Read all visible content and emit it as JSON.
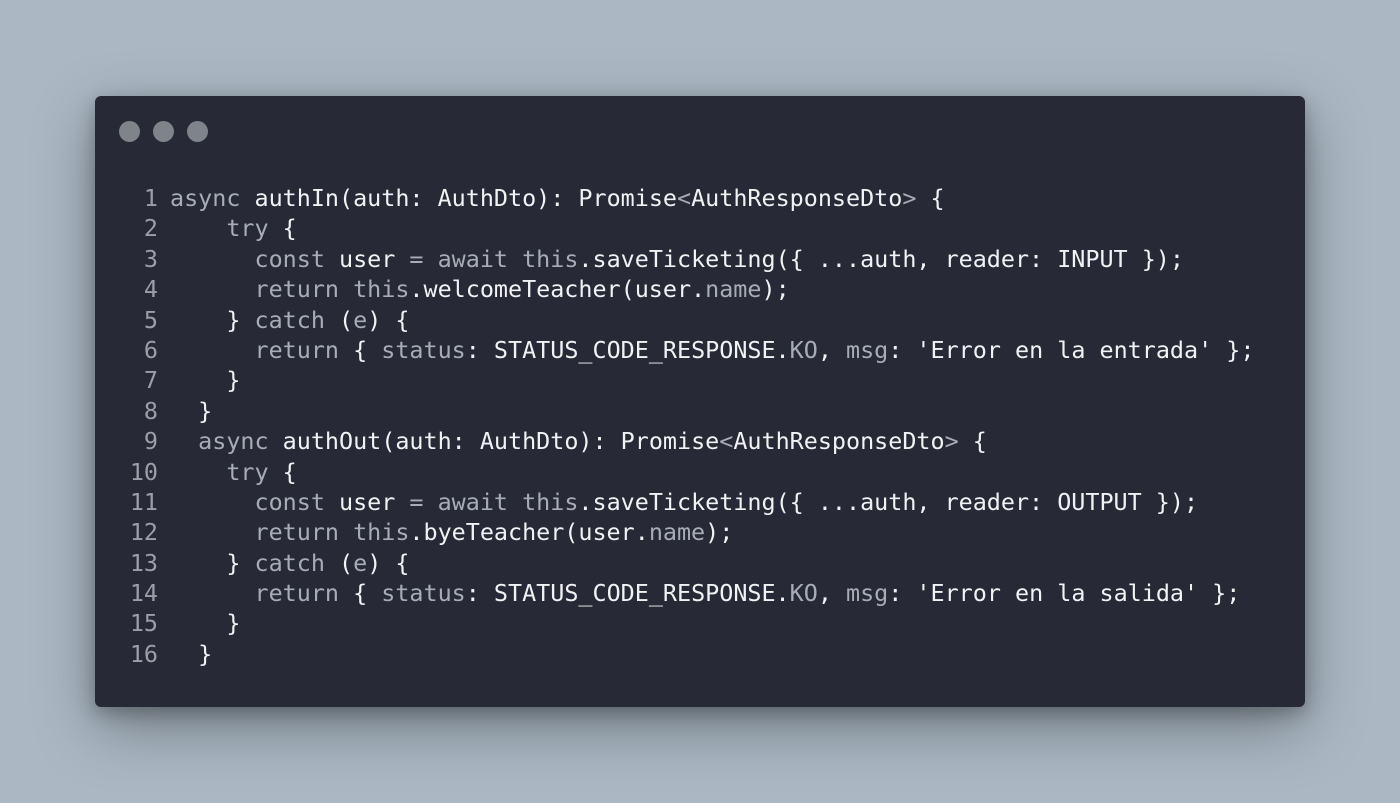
{
  "window": {
    "controls": [
      "close-icon",
      "minimize-icon",
      "maximize-icon"
    ],
    "background": "#272a36",
    "page_background": "#abb8c4"
  },
  "code": {
    "lines": [
      {
        "n": "1",
        "tokens": [
          [
            "kw",
            "async "
          ],
          [
            "fn",
            "authIn"
          ],
          [
            "fn",
            "(auth: "
          ],
          [
            "ty",
            "AuthDto"
          ],
          [
            "fn",
            "): "
          ],
          [
            "ty",
            "Promise"
          ],
          [
            "kw",
            "<"
          ],
          [
            "ty",
            "AuthResponseDto"
          ],
          [
            "kw",
            ">"
          ],
          [
            "fn",
            " {"
          ]
        ]
      },
      {
        "n": "2",
        "tokens": [
          [
            "fn",
            "    "
          ],
          [
            "kw",
            "try"
          ],
          [
            "fn",
            " {"
          ]
        ]
      },
      {
        "n": "3",
        "tokens": [
          [
            "fn",
            "      "
          ],
          [
            "kw",
            "const "
          ],
          [
            "fn",
            "user "
          ],
          [
            "kw",
            "= await this"
          ],
          [
            "fn",
            ".saveTicketing({ ...auth, reader: INPUT });"
          ]
        ]
      },
      {
        "n": "4",
        "tokens": [
          [
            "fn",
            "      "
          ],
          [
            "kw",
            "return this"
          ],
          [
            "fn",
            ".welcomeTeacher(user."
          ],
          [
            "pr",
            "name"
          ],
          [
            "fn",
            ");"
          ]
        ]
      },
      {
        "n": "5",
        "tokens": [
          [
            "fn",
            "    } "
          ],
          [
            "kw",
            "catch"
          ],
          [
            "fn",
            " ("
          ],
          [
            "pr",
            "e"
          ],
          [
            "fn",
            ") {"
          ]
        ]
      },
      {
        "n": "6",
        "tokens": [
          [
            "fn",
            "      "
          ],
          [
            "kw",
            "return"
          ],
          [
            "fn",
            " { "
          ],
          [
            "pr",
            "status"
          ],
          [
            "fn",
            ": STATUS_CODE_RESPONSE."
          ],
          [
            "pr",
            "KO"
          ],
          [
            "fn",
            ", "
          ],
          [
            "pr",
            "msg"
          ],
          [
            "fn",
            ": "
          ],
          [
            "st",
            "'Error en la entrada'"
          ],
          [
            "fn",
            " };"
          ]
        ]
      },
      {
        "n": "7",
        "tokens": [
          [
            "fn",
            "    }"
          ]
        ]
      },
      {
        "n": "8",
        "tokens": [
          [
            "fn",
            "  }"
          ]
        ]
      },
      {
        "n": "9",
        "tokens": [
          [
            "fn",
            "  "
          ],
          [
            "kw",
            "async "
          ],
          [
            "fn",
            "authOut(auth: "
          ],
          [
            "ty",
            "AuthDto"
          ],
          [
            "fn",
            "): "
          ],
          [
            "ty",
            "Promise"
          ],
          [
            "kw",
            "<"
          ],
          [
            "ty",
            "AuthResponseDto"
          ],
          [
            "kw",
            ">"
          ],
          [
            "fn",
            " {"
          ]
        ]
      },
      {
        "n": "10",
        "tokens": [
          [
            "fn",
            "    "
          ],
          [
            "kw",
            "try"
          ],
          [
            "fn",
            " {"
          ]
        ]
      },
      {
        "n": "11",
        "tokens": [
          [
            "fn",
            "      "
          ],
          [
            "kw",
            "const "
          ],
          [
            "fn",
            "user "
          ],
          [
            "kw",
            "= await this"
          ],
          [
            "fn",
            ".saveTicketing({ ...auth, reader: OUTPUT });"
          ]
        ]
      },
      {
        "n": "12",
        "tokens": [
          [
            "fn",
            "      "
          ],
          [
            "kw",
            "return this"
          ],
          [
            "fn",
            ".byeTeacher(user."
          ],
          [
            "pr",
            "name"
          ],
          [
            "fn",
            ");"
          ]
        ]
      },
      {
        "n": "13",
        "tokens": [
          [
            "fn",
            "    } "
          ],
          [
            "kw",
            "catch"
          ],
          [
            "fn",
            " ("
          ],
          [
            "pr",
            "e"
          ],
          [
            "fn",
            ") {"
          ]
        ]
      },
      {
        "n": "14",
        "tokens": [
          [
            "fn",
            "      "
          ],
          [
            "kw",
            "return"
          ],
          [
            "fn",
            " { "
          ],
          [
            "pr",
            "status"
          ],
          [
            "fn",
            ": STATUS_CODE_RESPONSE."
          ],
          [
            "pr",
            "KO"
          ],
          [
            "fn",
            ", "
          ],
          [
            "pr",
            "msg"
          ],
          [
            "fn",
            ": "
          ],
          [
            "st",
            "'Error en la salida'"
          ],
          [
            "fn",
            " };"
          ]
        ]
      },
      {
        "n": "15",
        "tokens": [
          [
            "fn",
            "    }"
          ]
        ]
      },
      {
        "n": "16",
        "tokens": [
          [
            "fn",
            "  }"
          ]
        ]
      }
    ]
  }
}
